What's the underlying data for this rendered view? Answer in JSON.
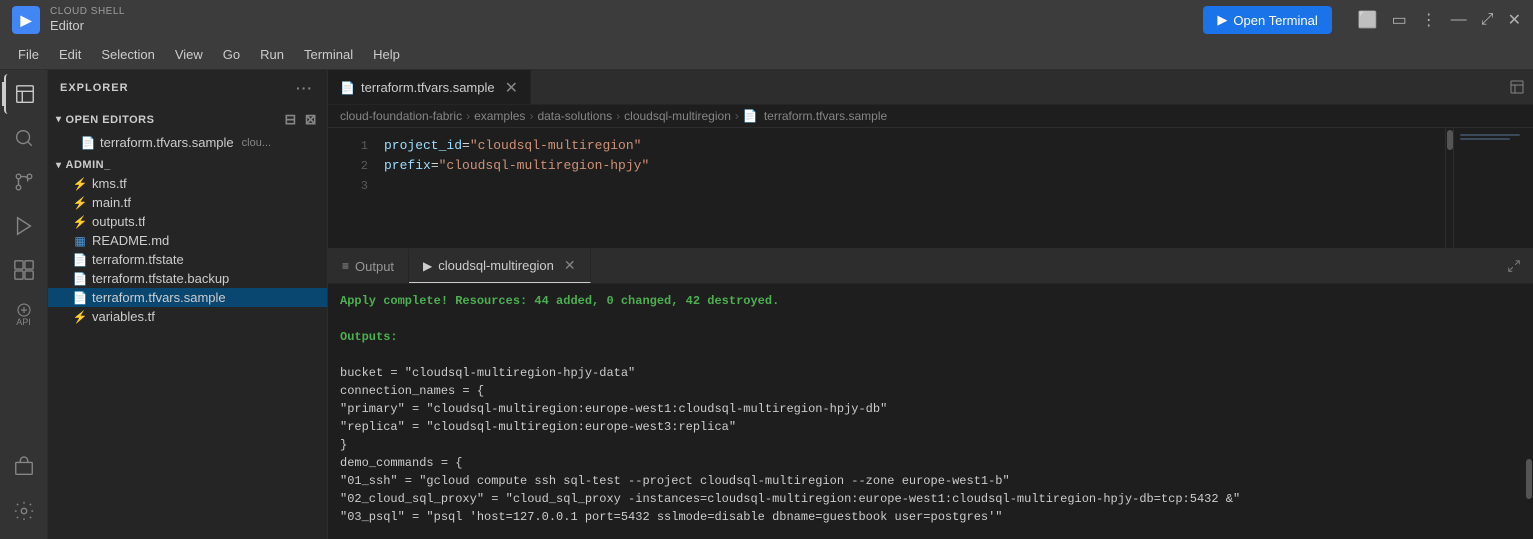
{
  "titleBar": {
    "logo": "▶",
    "subtitle": "CLOUD SHELL",
    "title": "Editor",
    "openTerminal": "Open Terminal",
    "icons": [
      "📷",
      "▭",
      "⋮",
      "✕",
      "⤢",
      "✕"
    ]
  },
  "menuBar": {
    "items": [
      "File",
      "Edit",
      "Selection",
      "View",
      "Go",
      "Run",
      "Terminal",
      "Help"
    ]
  },
  "activityBar": {
    "icons": [
      {
        "name": "explorer-icon",
        "symbol": "⬚",
        "active": true
      },
      {
        "name": "search-icon",
        "symbol": "🔍"
      },
      {
        "name": "source-control-icon",
        "symbol": "⑂"
      },
      {
        "name": "run-debug-icon",
        "symbol": "▷"
      },
      {
        "name": "extensions-icon",
        "symbol": "⊞"
      },
      {
        "name": "api-icon",
        "symbol": "◈",
        "label": "API"
      },
      {
        "name": "remote-icon",
        "symbol": "⊡"
      },
      {
        "name": "settings-icon",
        "symbol": "⚙"
      }
    ]
  },
  "sidebar": {
    "header": "EXPLORER",
    "openEditors": {
      "label": "OPEN EDITORS",
      "items": [
        {
          "name": "terraform.tfvars.sample",
          "extra": "clou...",
          "icon": "📄"
        }
      ]
    },
    "admin": {
      "label": "ADMIN_",
      "items": [
        {
          "name": "kms.tf",
          "icon": "⚡",
          "type": "tf"
        },
        {
          "name": "main.tf",
          "icon": "⚡",
          "type": "tf"
        },
        {
          "name": "outputs.tf",
          "icon": "⚡",
          "type": "tf"
        },
        {
          "name": "README.md",
          "icon": "▦",
          "type": "md"
        },
        {
          "name": "terraform.tfstate",
          "icon": "📄",
          "type": "file"
        },
        {
          "name": "terraform.tfstate.backup",
          "icon": "📄",
          "type": "file"
        },
        {
          "name": "terraform.tfvars.sample",
          "icon": "📄",
          "type": "file",
          "active": true
        },
        {
          "name": "variables.tf",
          "icon": "⚡",
          "type": "tf"
        }
      ]
    }
  },
  "editor": {
    "tab": {
      "filename": "terraform.tfvars.sample",
      "icon": "📄"
    },
    "breadcrumb": [
      "cloud-foundation-fabric",
      "examples",
      "data-solutions",
      "cloudsql-multiregion",
      "terraform.tfvars.sample"
    ],
    "lines": [
      {
        "num": "1",
        "key": "project_id",
        "op": " = ",
        "value": "\"cloudsql-multiregion\""
      },
      {
        "num": "2",
        "key": "prefix",
        "op": "    = ",
        "value": "\"cloudsql-multiregion-hpjy\""
      },
      {
        "num": "3",
        "key": "",
        "op": "",
        "value": ""
      }
    ]
  },
  "panel": {
    "tabs": [
      {
        "label": "Output",
        "icon": "≡",
        "active": false
      },
      {
        "label": "cloudsql-multiregion",
        "icon": "▶",
        "active": true,
        "closeable": true
      }
    ],
    "content": {
      "line1": "Apply complete! Resources: 44 added, 0 changed, 42 destroyed.",
      "line2": "",
      "line3": "Outputs:",
      "line4": "",
      "line5": "bucket = \"cloudsql-multiregion-hpjy-data\"",
      "line6": "connection_names = {",
      "line7": "  \"primary\" = \"cloudsql-multiregion:europe-west1:cloudsql-multiregion-hpjy-db\"",
      "line8": "  \"replica\" = \"cloudsql-multiregion:europe-west3:replica\"",
      "line9": "}",
      "line10": "demo_commands = {",
      "line11": "  \"01_ssh\" = \"gcloud compute ssh sql-test --project cloudsql-multiregion --zone europe-west1-b\"",
      "line12": "  \"02_cloud_sql_proxy\" = \"cloud_sql_proxy -instances=cloudsql-multiregion:europe-west1:cloudsql-multiregion-hpjy-db=tcp:5432 &\"",
      "line13": "  \"03_psql\" = \"psql 'host=127.0.0.1 port=5432 sslmode=disable dbname=guestbook user=postgres'\""
    }
  }
}
